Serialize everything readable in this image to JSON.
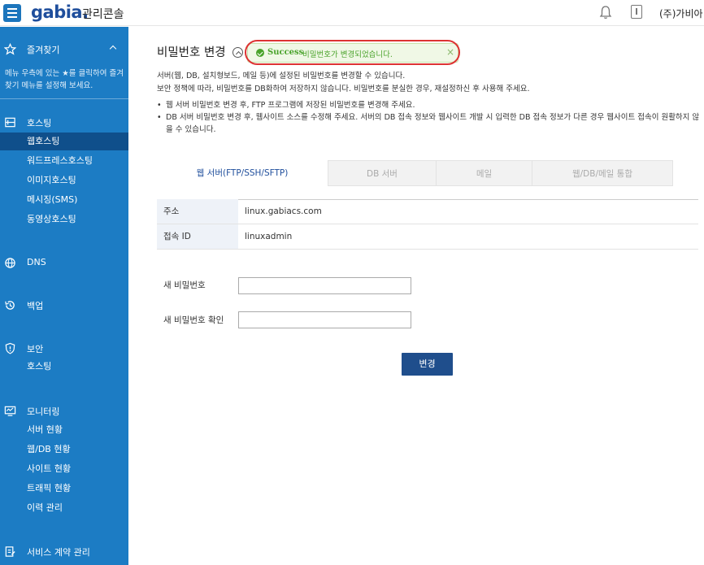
{
  "header": {
    "logo": "gabia.",
    "console_title": "관리콘솔",
    "company": "(주)가비아"
  },
  "sidebar": {
    "favorites": {
      "label": "즐겨찾기",
      "description": "메뉴 우측에 있는 ★를 클릭하여 즐겨찾기 메뉴를 설정해 보세요."
    },
    "hosting": {
      "label": "호스팅",
      "items": [
        "웹호스팅",
        "워드프레스호스팅",
        "이미지호스팅",
        "메시징(SMS)",
        "동영상호스팅"
      ]
    },
    "dns": {
      "label": "DNS"
    },
    "backup": {
      "label": "백업"
    },
    "security": {
      "label": "보안",
      "items": [
        "호스팅"
      ]
    },
    "monitoring": {
      "label": "모니터링",
      "items": [
        "서버 현황",
        "웹/DB 현황",
        "사이트 현황",
        "트래픽 현황",
        "이력 관리"
      ]
    },
    "contract": {
      "label": "서비스 계약 관리"
    }
  },
  "page": {
    "title": "비밀번호 변경",
    "toast": {
      "status": "Success",
      "message": "비밀번호가 변경되었습니다.",
      "close": "×"
    },
    "desc_line1": "서버(웹, DB, 설치형보드, 메일 등)에 설정된 비밀번호를 변경할 수 있습니다.",
    "desc_line2": "보안 정책에 따라, 비밀번호를 DB화하여 저장하지 않습니다. 비밀번호를 분실한 경우, 재설정하신 후 사용해 주세요.",
    "bullets": [
      "웹 서버 비밀번호 변경 후, FTP 프로그램에 저장된 비밀번호를 변경해 주세요.",
      "DB 서버 비밀번호 변경 후, 웹사이트 소스를 수정해 주세요. 서버의 DB 접속 정보와 웹사이트 개발 시 입력한 DB 접속 정보가 다른 경우 웹사이트 접속이 원활하지 않을 수 있습니다."
    ],
    "tabs": [
      "웹 서버(FTP/SSH/SFTP)",
      "DB 서버",
      "메일",
      "웹/DB/메일 통합"
    ],
    "info": [
      {
        "key": "주소",
        "value": "linux.gabiacs.com"
      },
      {
        "key": "접속 ID",
        "value": "linuxadmin"
      }
    ],
    "form": {
      "new_password_label": "새 비밀번호",
      "new_password_value": "",
      "confirm_label": "새 비밀번호 확인",
      "confirm_value": ""
    },
    "submit_label": "변경"
  }
}
